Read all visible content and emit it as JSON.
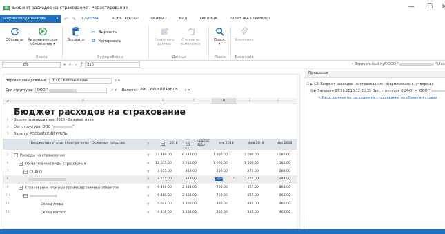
{
  "window": {
    "title": "Бюджет расходов на страхование - Редактирование",
    "minimize": "—",
    "maximize": "☐",
    "close": "✕"
  },
  "menubar": {
    "form_button": "Форма ввода/вывода",
    "tabs": [
      "ГЛАВНАЯ",
      "КОНСТРУКТОР",
      "ФОРМАТ",
      "ВИД",
      "ТАБЛИЦА",
      "РАЗМЕТКА СТРАНИЦЫ"
    ]
  },
  "ribbon": {
    "refresh": "Обновить",
    "auto_refresh": "Автоматическое обновление",
    "paste": "Вставить",
    "cut": "Вырезать",
    "copy": "Копировать",
    "save_data": "Сохранить данные",
    "undo_changes": "Отменить изменения",
    "search": "Поиск",
    "attachments": "Вложения",
    "groups": {
      "form": "Форма",
      "clipboard": "Буфер обмена",
      "data": "Данные",
      "search": "Поиск",
      "attachments": "Вложения"
    }
  },
  "formula_bar": {
    "cell": "D9",
    "value": "250",
    "cube": "• Виртуальный куб!ООО \"",
    "cube_tail": "\"(Ана"
  },
  "params": {
    "version_label": "Версия планирования:",
    "version_value": "2018 - Базовый план",
    "org_label": "Орг структура:",
    "org_value": "ООО \"",
    "currency_label": "Валюта:",
    "currency_value": "РОССИЙСКИЙ РУБЛЬ"
  },
  "columns": [
    "A",
    "B",
    "C",
    "D",
    "E",
    "F"
  ],
  "report": {
    "title": "Бюджет расходов на страхование",
    "line1": "Версия планирования: 2018 - Базовый план",
    "line2": "Орг структура: ООО \"",
    "line2_tail": "\"",
    "line3": "Валюта: РОССИЙСКИЙ РУБЛЬ",
    "header_col": "Бюджетные статьи / Контрагенты / Основные средства",
    "header_2018": "2018",
    "header_q1a": "1 квартал",
    "header_q1b": "2018",
    "header_jan": "янв 2018",
    "header_feb": "фев 2018",
    "header_mar": "мар 2018"
  },
  "rows": [
    {
      "num": "5",
      "label": "Расходы на страхование",
      "v": [
        "23 369.00",
        "6 177.00",
        "1 900.00",
        "2 090.00",
        "2 187.00"
      ]
    },
    {
      "num": "6",
      "label": "Обязательные виды страхования",
      "v": [
        "12 615.00",
        "3 281.00",
        "1 000.00",
        "1 100.00",
        "1 181.00"
      ]
    },
    {
      "num": "7",
      "label": "ОСАГО",
      "v": [
        "3 155.00",
        "813.00",
        "250.00",
        "275.00",
        "288.00"
      ]
    },
    {
      "num": "8",
      "label": "",
      "v": [
        "3 155.00",
        "813.00",
        "250",
        "275.00",
        "288.00"
      ]
    },
    {
      "num": "9",
      "label": "Страхование опасных производственных объектов",
      "v": [
        "9 460.00",
        "2 438.00",
        "750.00",
        "825.00",
        "863.00"
      ]
    },
    {
      "num": "10",
      "label": "",
      "v": [
        "9 460.00",
        "2 438.00",
        "750.00",
        "825.00",
        "863.00"
      ]
    },
    {
      "num": "11",
      "label": "Склад хлора",
      "v": [
        "5 044.00",
        "1 300.00",
        "400.00",
        "440.00",
        "460.00"
      ]
    },
    {
      "num": "12",
      "label": "Склад кислот",
      "v": [
        "4 416.00",
        "1 138.00",
        "350.00",
        "385.00",
        "403.00"
      ]
    }
  ],
  "processes": {
    "title": "Процессы",
    "item1": "L3. Бюджет расходов на страхование - формирование, утвержде",
    "item2": "Запущен 17.10.2018 12:50:35 Орг. структура ([ЦФО] = 'ООО \"",
    "item3": "Ввод данных по расходам на страхование по объектам страхо"
  },
  "colors": {
    "accent": "#1e6fbf",
    "selected_cell": "#1e6fbf"
  }
}
